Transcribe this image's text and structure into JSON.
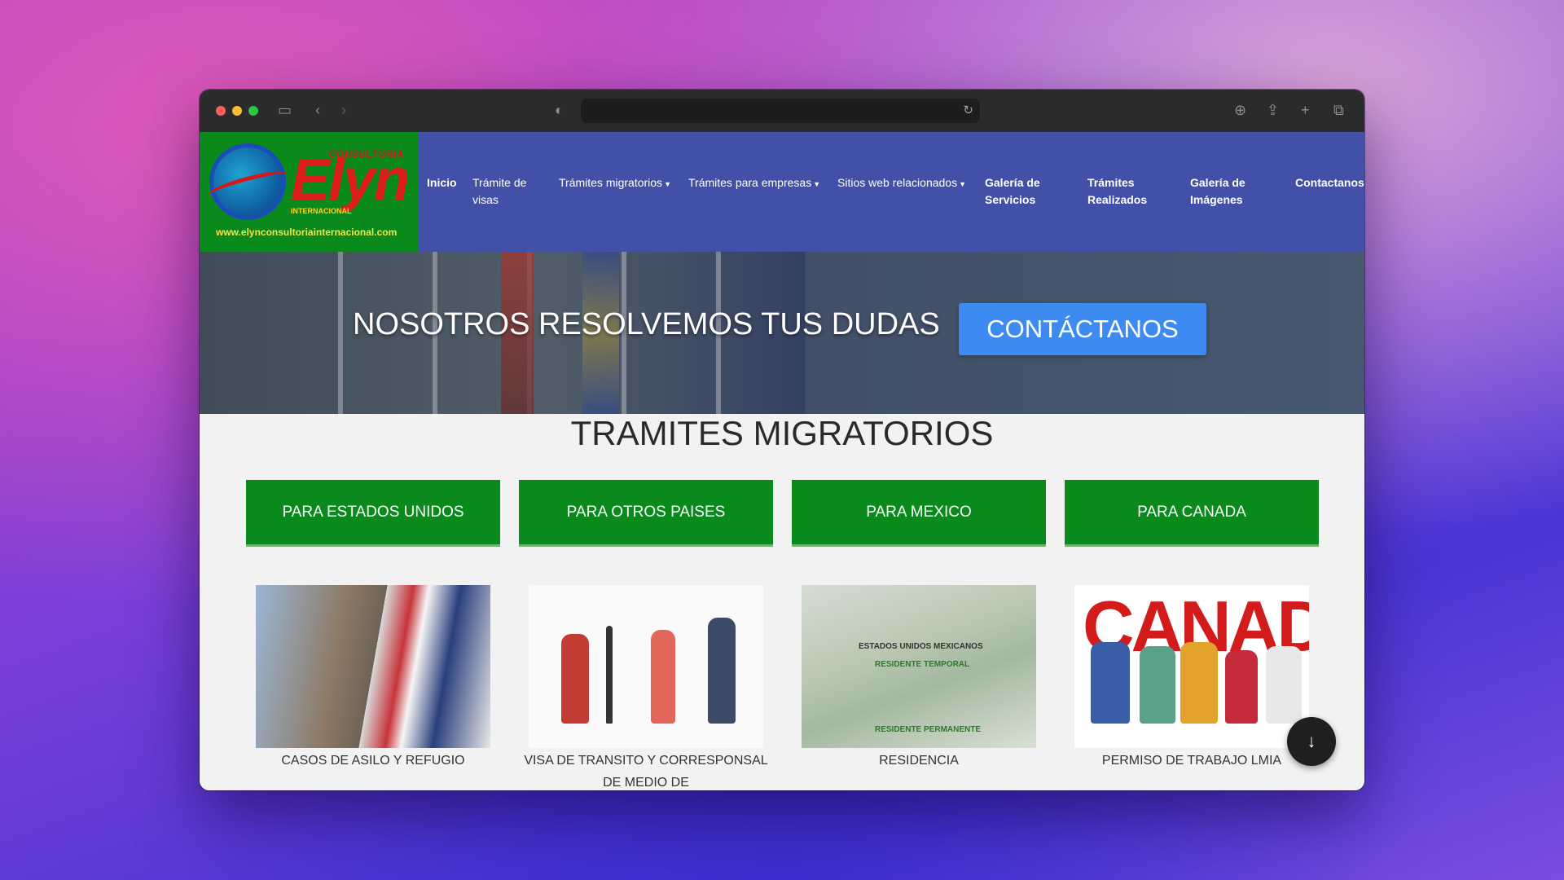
{
  "browser": {
    "icons": [
      "sidebar-icon",
      "back-icon",
      "forward-icon",
      "shield-icon",
      "reload-icon",
      "download-icon",
      "share-icon",
      "new-tab-icon",
      "tabs-overview-icon"
    ],
    "url": ""
  },
  "logo": {
    "brand": "Elyn",
    "consultoria": "CONSULTORIA",
    "internacional": "INTERNACIONAL",
    "url": "www.elynconsultoriainternacional.com"
  },
  "nav": {
    "inicio": "Inicio",
    "tramite_visas": "Trámite de visas",
    "tramites_migratorios": "Trámites migratorios",
    "tramites_empresas": "Trámites para empresas",
    "sitios_web": "Sitios web relacionados",
    "galeria_servicios": "Galería de Servicios",
    "tramites_realizados": "Trámites Realizados",
    "galeria_imagenes": "Galería de Imágenes",
    "contactanos": "Contactanos"
  },
  "hero": {
    "headline": "NOSOTROS RESOLVEMOS TUS DUDAS",
    "cta": "CONTÁCTANOS"
  },
  "section": {
    "title": "TRAMITES MIGRATORIOS",
    "buttons": [
      "PARA ESTADOS UNIDOS",
      "PARA OTROS PAISES",
      "PARA MEXICO",
      "PARA CANADA"
    ],
    "cards": [
      {
        "label": "CASOS DE ASILO Y REFUGIO"
      },
      {
        "label": "VISA DE TRANSITO Y CORRESPONSAL DE MEDIO DE"
      },
      {
        "label": "RESIDENCIA"
      },
      {
        "label": "PERMISO DE TRABAJO LMIA"
      }
    ],
    "residencia_img_text": [
      "ESTADOS UNIDOS MEXICANOS",
      "RESIDENTE TEMPORAL",
      "RESIDENTE PERMANENTE"
    ],
    "canada_img_text": "CANADA"
  },
  "colors": {
    "nav_bg": "#4350a8",
    "green": "#0a8a1c",
    "cta_blue": "#3d8bf0"
  }
}
